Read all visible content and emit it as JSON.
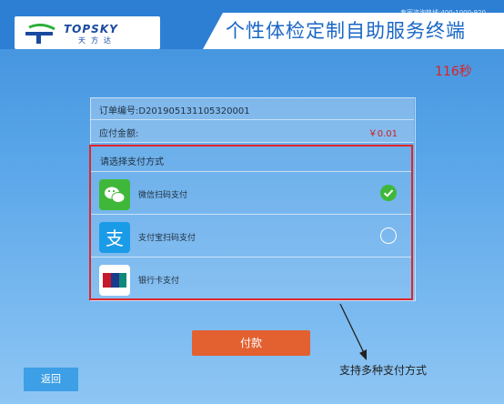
{
  "header": {
    "logo_text": "TOPSKY",
    "logo_sub": "天方达",
    "title": "个性体检定制自助服务终端",
    "hotline": "专家咨询热线:400-1000-920"
  },
  "timer": "116秒",
  "order": {
    "number_label": "订单编号:D201905131105320001",
    "amount_label": "应付金额:",
    "amount_value": "￥0.01"
  },
  "payment": {
    "heading": "请选择支付方式",
    "methods": [
      {
        "label": "微信扫码支付",
        "icon": "wechat-icon",
        "color": "#3fb83a",
        "selected": true
      },
      {
        "label": "支付宝扫码支付",
        "icon": "alipay-icon",
        "color": "#1a9be8",
        "selected": false
      },
      {
        "label": "银行卡支付",
        "icon": "unionpay-icon",
        "color": "#c8182c",
        "selected": false
      }
    ]
  },
  "buttons": {
    "pay": "付款",
    "back": "返回"
  },
  "annotation": "支持多种支付方式",
  "colors": {
    "highlight_border": "#e0262c",
    "pay_button": "#e36030",
    "timer": "#e02020"
  }
}
